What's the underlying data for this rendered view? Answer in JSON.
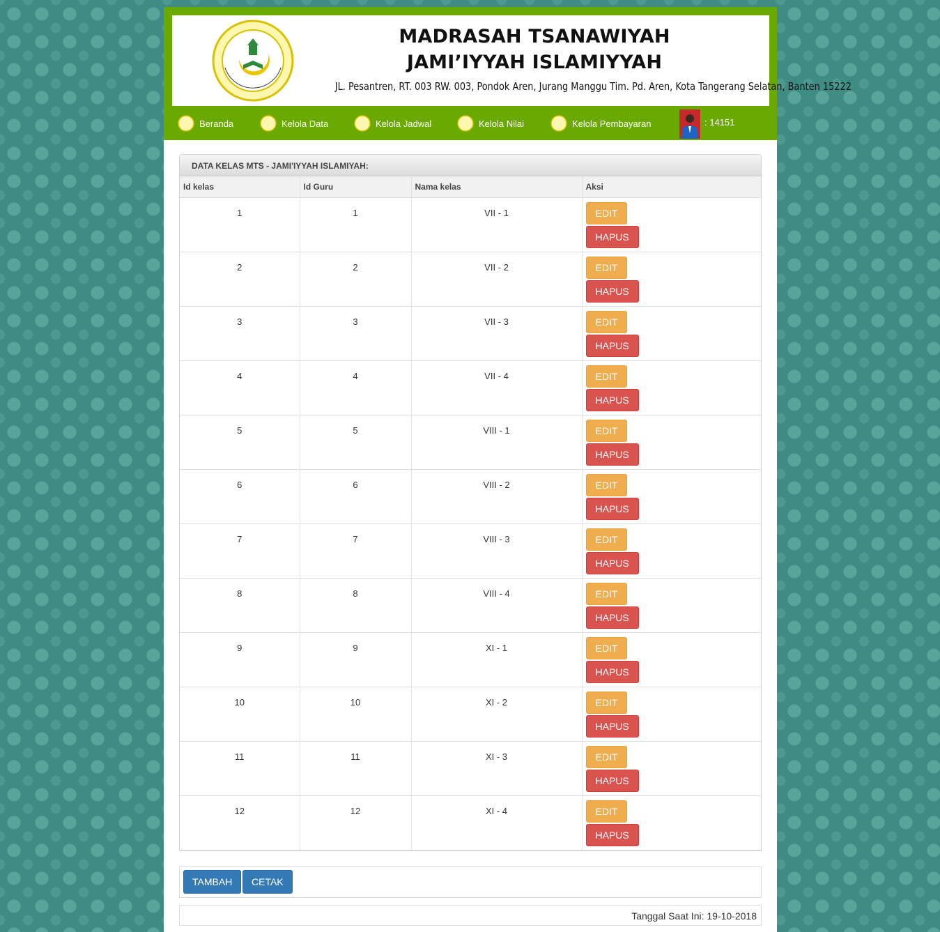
{
  "header": {
    "school_name_line1": "MADRASAH TSANAWIYAH",
    "school_name_line2": "JAMI’IYYAH ISLAMIYYAH",
    "address": "JL. Pesantren, RT. 003 RW. 003, Pondok Aren, Jurang Manggu Tim. Pd. Aren, Kota Tangerang Selatan, Banten 15222",
    "logo_text": "MTs. JAMI'IYYAH ISLAMIYYAH"
  },
  "nav": {
    "items": [
      {
        "label": "Beranda"
      },
      {
        "label": "Kelola Data"
      },
      {
        "label": "Kelola Jadwal"
      },
      {
        "label": "Kelola Nilai"
      },
      {
        "label": "Kelola Pembayaran"
      }
    ],
    "user_id": ":  14151"
  },
  "panel": {
    "title": "DATA KELAS MTS - JAMI'IYYAH ISLAMIYAH:",
    "columns": [
      "Id kelas",
      "Id Guru",
      "Nama kelas",
      "Aksi"
    ],
    "edit_label": "EDIT",
    "delete_label": "HAPUS",
    "rows": [
      {
        "id_kelas": "1",
        "id_guru": "1",
        "nama_kelas": "VII - 1"
      },
      {
        "id_kelas": "2",
        "id_guru": "2",
        "nama_kelas": "VII - 2"
      },
      {
        "id_kelas": "3",
        "id_guru": "3",
        "nama_kelas": "VII - 3"
      },
      {
        "id_kelas": "4",
        "id_guru": "4",
        "nama_kelas": "VII - 4"
      },
      {
        "id_kelas": "5",
        "id_guru": "5",
        "nama_kelas": "VIII - 1"
      },
      {
        "id_kelas": "6",
        "id_guru": "6",
        "nama_kelas": "VIII - 2"
      },
      {
        "id_kelas": "7",
        "id_guru": "7",
        "nama_kelas": "VIII - 3"
      },
      {
        "id_kelas": "8",
        "id_guru": "8",
        "nama_kelas": "VIII - 4"
      },
      {
        "id_kelas": "9",
        "id_guru": "9",
        "nama_kelas": "XI - 1"
      },
      {
        "id_kelas": "10",
        "id_guru": "10",
        "nama_kelas": "XI - 2"
      },
      {
        "id_kelas": "11",
        "id_guru": "11",
        "nama_kelas": "XI - 3"
      },
      {
        "id_kelas": "12",
        "id_guru": "12",
        "nama_kelas": "XI - 4"
      }
    ]
  },
  "actions": {
    "add_label": "TAMBAH",
    "print_label": "CETAK"
  },
  "footer": {
    "date_text": "Tanggal Saat Ini: 19-10-2018"
  },
  "colors": {
    "header_green": "#6aa900",
    "edit_orange": "#f0ad4e",
    "delete_red": "#d9534f",
    "primary_blue": "#337ab7",
    "background_teal": "#3f8c84"
  }
}
